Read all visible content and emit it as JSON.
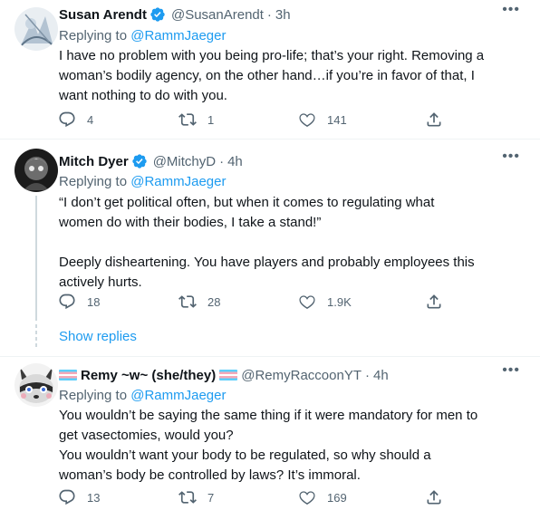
{
  "tweets": [
    {
      "name": "Susan Arendt",
      "handle": "@SusanArendt",
      "dot": "·",
      "time": "3h",
      "reply_prefix": "Replying to",
      "reply_to": "@RammJaeger",
      "text": "I have no problem with you being pro-life; that’s your right. Removing a\nwoman’s bodily agency, on the other hand…if you’re in favor of that, I\nwant nothing to do with you.",
      "replies": "4",
      "retweets": "1",
      "likes": "141",
      "verified": true
    },
    {
      "name": "Mitch Dyer",
      "handle": "@MitchyD",
      "dot": "·",
      "time": "4h",
      "reply_prefix": "Replying to",
      "reply_to": "@RammJaeger",
      "text": "“I don’t get political often, but when it comes to regulating what\nwomen do with their bodies, I take a stand!”\n\nDeeply disheartening. You have players and probably employees this\nactively hurts.",
      "replies": "18",
      "retweets": "28",
      "likes": "1.9K",
      "verified": true
    },
    {
      "name": "Remy ~w~ (she/they)",
      "handle": "@RemyRaccoonYT",
      "dot": "·",
      "time": "4h",
      "reply_prefix": "Replying to",
      "reply_to": "@RammJaeger",
      "text": "You wouldn’t be saying the same thing if it were mandatory for men to\nget vasectomies, would you?\nYou wouldn’t want your body to be regulated, so why should a\nwoman’s body be controlled by laws? It’s immoral.",
      "replies": "13",
      "retweets": "7",
      "likes": "169",
      "verified": false
    }
  ],
  "show_replies": "Show replies",
  "colors": {
    "link": "#1d9bf0",
    "muted": "#536471",
    "text": "#0f1419",
    "verified": "#1d9bf0"
  },
  "icons": [
    "more-icon",
    "reply-icon",
    "retweet-icon",
    "like-icon",
    "share-icon",
    "verified-badge-icon",
    "trans-flag-emoji"
  ]
}
